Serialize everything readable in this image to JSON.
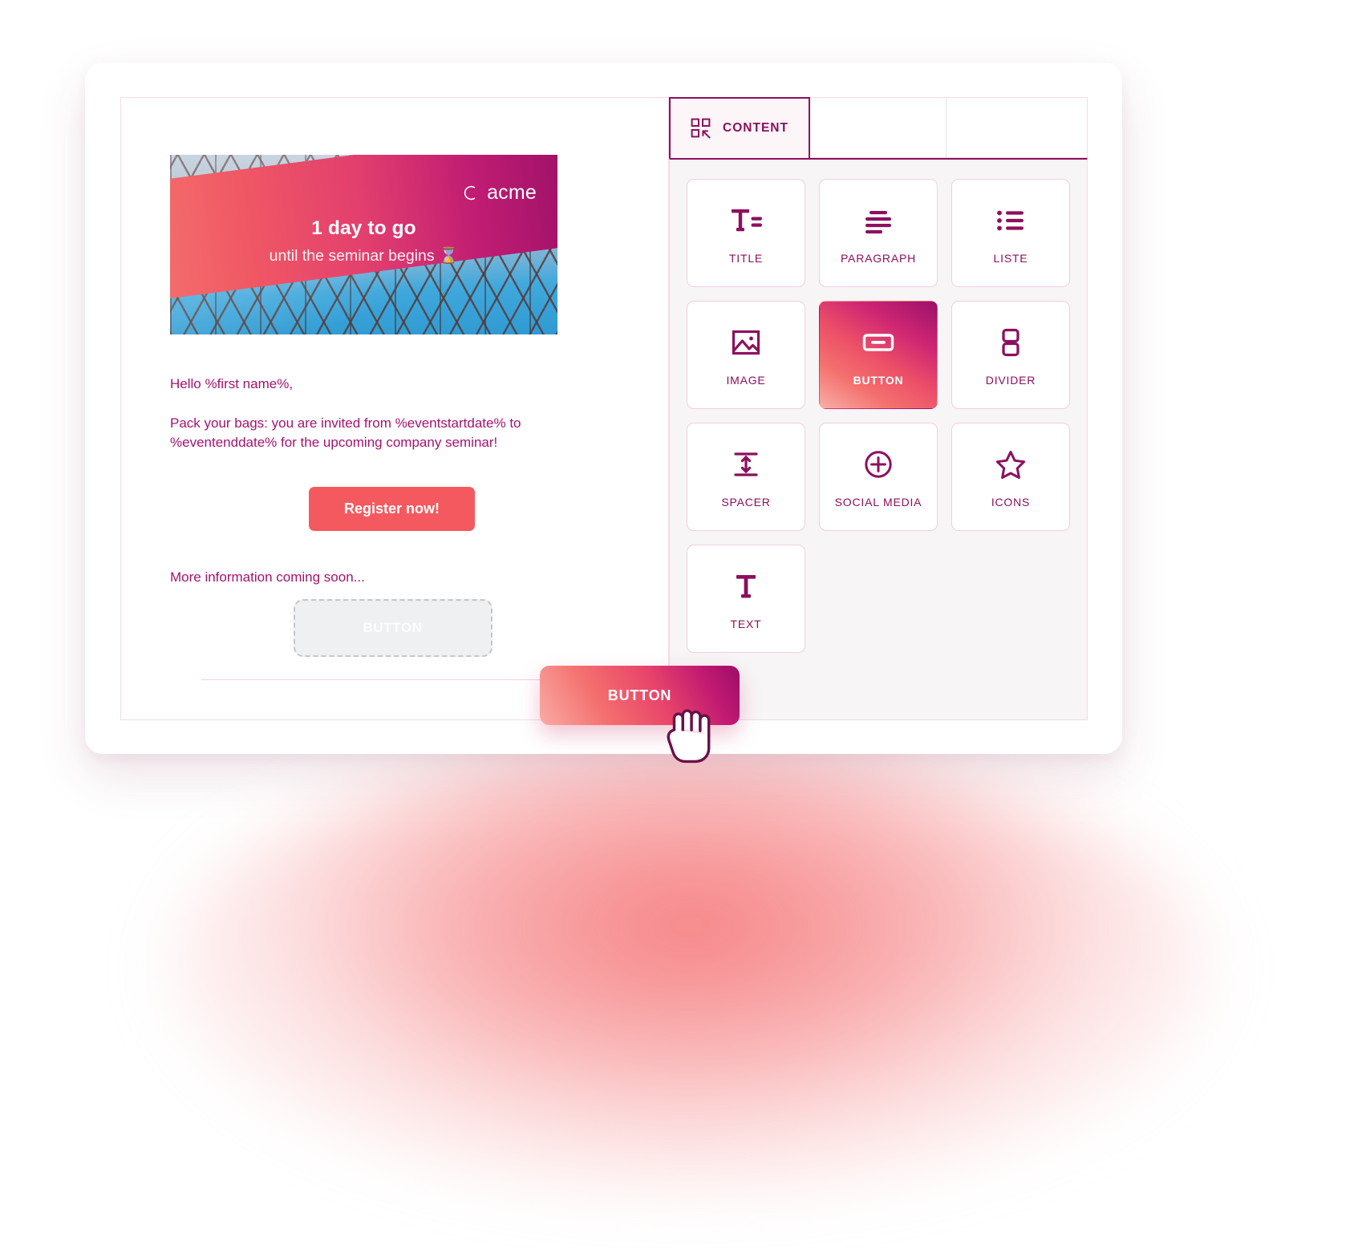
{
  "window": {
    "tabs": [
      {
        "label": "CONTENT",
        "icon": "grid-cursor-icon",
        "active": true
      },
      {
        "label": "",
        "icon": "",
        "active": false
      },
      {
        "label": "",
        "icon": "",
        "active": false
      }
    ]
  },
  "email": {
    "hero": {
      "brand": "acme",
      "brand_mark": "circle-logo-icon",
      "headline": "1 day to go",
      "subline": "until the seminar begins ⌛"
    },
    "greeting": "Hello %first name%,",
    "body": "Pack your bags: you are invited from %eventstartdate% to %eventenddate% for the upcoming company seminar!",
    "cta_label": "Register now!",
    "footer_note": "More information coming soon...",
    "dropzone_label": "BUTTON"
  },
  "drag": {
    "ghost_label": "BUTTON",
    "cursor": "grabbing-hand-cursor"
  },
  "palette": {
    "title": "CONTENT",
    "blocks": [
      {
        "label": "TITLE",
        "icon": "title-icon",
        "active": false
      },
      {
        "label": "PARAGRAPH",
        "icon": "paragraph-icon",
        "active": false
      },
      {
        "label": "LISTE",
        "icon": "list-icon",
        "active": false
      },
      {
        "label": "IMAGE",
        "icon": "image-icon",
        "active": false
      },
      {
        "label": "BUTTON",
        "icon": "button-icon",
        "active": true
      },
      {
        "label": "DIVIDER",
        "icon": "divider-icon",
        "active": false
      },
      {
        "label": "SPACER",
        "icon": "spacer-icon",
        "active": false
      },
      {
        "label": "SOCIAL MEDIA",
        "icon": "social-media-icon",
        "active": false
      },
      {
        "label": "ICONS",
        "icon": "star-icon",
        "active": false
      },
      {
        "label": "TEXT",
        "icon": "text-icon",
        "active": false
      }
    ]
  },
  "colors": {
    "brand_magenta": "#8d0f5e",
    "text_magenta": "#a4136f",
    "cta_red": "#f4595f",
    "gradient_start": "#f9aba6",
    "gradient_end": "#9d0d68",
    "panel_bg": "#f7f5f6",
    "card_border": "#f0cfdf"
  }
}
